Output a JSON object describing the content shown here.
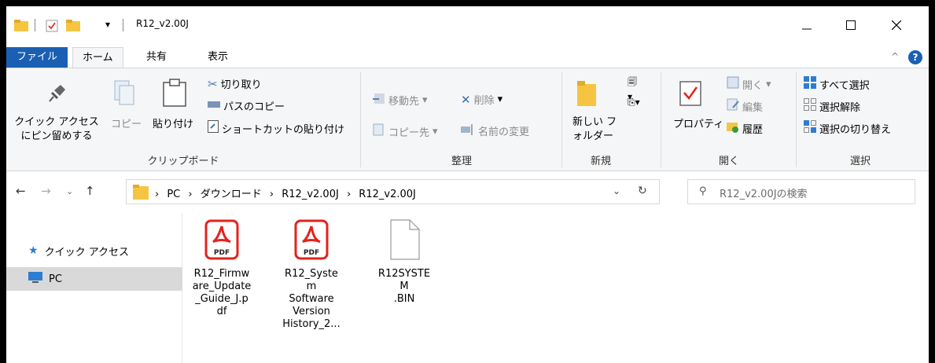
{
  "window": {
    "title": "R12_v2.00J"
  },
  "tabs": {
    "file": "ファイル",
    "home": "ホーム",
    "share": "共有",
    "view": "表示"
  },
  "ribbon": {
    "clipboard": {
      "pin": "クイック アクセス にピン留めする",
      "copy": "コピー",
      "paste": "貼り付け",
      "cut": "切り取り",
      "copy_path": "パスのコピー",
      "paste_shortcut": "ショートカットの貼り付け",
      "label": "クリップボード"
    },
    "organize": {
      "move_to": "移動先",
      "copy_to": "コピー先",
      "delete": "削除",
      "rename": "名前の変更",
      "label": "整理"
    },
    "new": {
      "new_folder": "新しい フォルダー",
      "label": "新規"
    },
    "open": {
      "properties": "プロパティ",
      "open": "開く",
      "edit": "編集",
      "history": "履歴",
      "label": "開く"
    },
    "select": {
      "select_all": "すべて選択",
      "select_none": "選択解除",
      "invert": "選択の切り替え",
      "label": "選択"
    }
  },
  "address": {
    "crumbs": [
      "PC",
      "ダウンロード",
      "R12_v2.00J",
      "R12_v2.00J"
    ],
    "search_placeholder": "R12_v2.00Jの検索"
  },
  "nav": {
    "quick_access": "クイック アクセス",
    "pc": "PC"
  },
  "files": [
    {
      "name": "R12_Firmware_Update_Guide_J.pdf",
      "lines": [
        "R12_Firmw",
        "are_Update",
        "_Guide_J.p",
        "df"
      ],
      "type": "pdf"
    },
    {
      "name": "R12_System Software Version History_2...",
      "lines": [
        "R12_System",
        "Software",
        "Version",
        "History_2..."
      ],
      "type": "pdf"
    },
    {
      "name": "R12SYSTEM.BIN",
      "lines": [
        "R12SYSTEM",
        ".BIN"
      ],
      "type": "bin"
    }
  ],
  "colors": {
    "accent": "#1a5fb4",
    "pdf_red": "#e3231c",
    "folder": "#f5c542"
  }
}
